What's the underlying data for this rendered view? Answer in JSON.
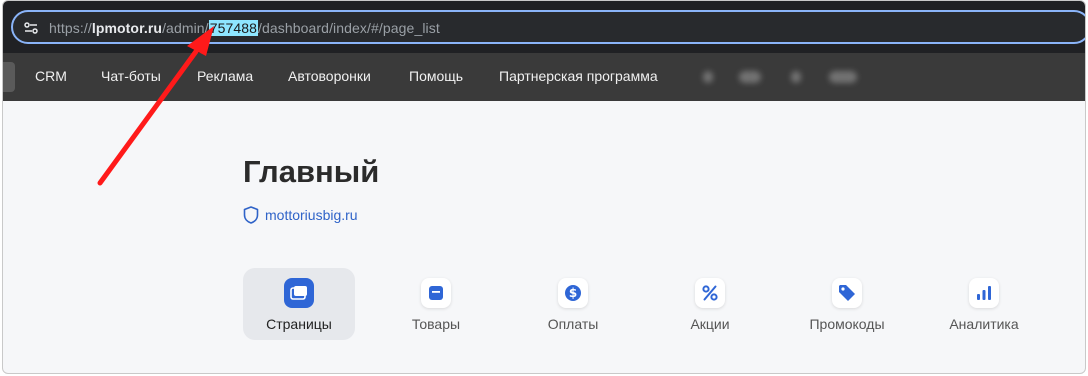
{
  "browser": {
    "url_prefix": "https://",
    "url_domain": "lpmotor.ru",
    "url_path_before": "/admin/",
    "url_highlight": "757488",
    "url_path_after": "/dashboard/index/#/page_list"
  },
  "navbar": {
    "items": [
      "CRM",
      "Чат-боты",
      "Реклама",
      "Автоворонки",
      "Помощь",
      "Партнерская программа"
    ]
  },
  "page": {
    "title": "Главный",
    "site_domain": "mottoriusbig.ru"
  },
  "tabs": [
    {
      "label": "Страницы",
      "icon": "pages-icon",
      "active": true
    },
    {
      "label": "Товары",
      "icon": "products-icon",
      "active": false
    },
    {
      "label": "Оплаты",
      "icon": "dollar-icon",
      "active": false
    },
    {
      "label": "Акции",
      "icon": "percent-icon",
      "active": false
    },
    {
      "label": "Промокоды",
      "icon": "tag-icon",
      "active": false
    },
    {
      "label": "Аналитика",
      "icon": "bar-chart-icon",
      "active": false
    }
  ],
  "colors": {
    "accent": "#2f66d6",
    "annotation_arrow": "#ff1a1a",
    "url_highlight": "#8ee6ff"
  }
}
